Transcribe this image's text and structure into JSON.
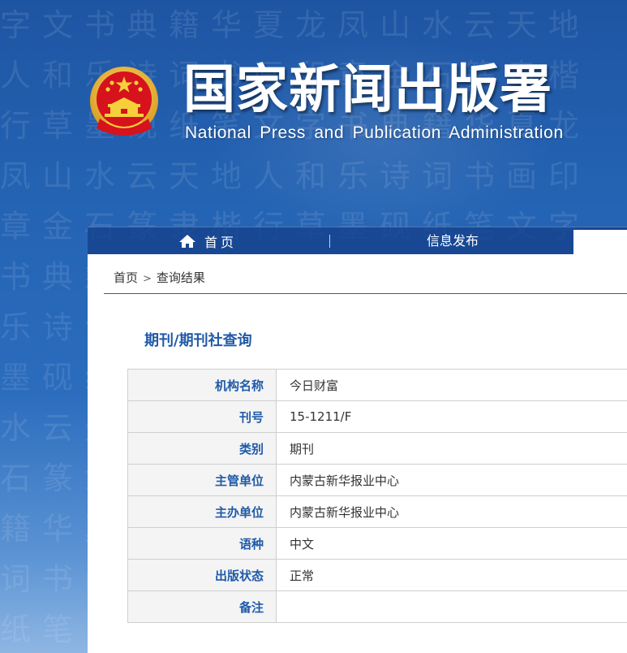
{
  "header": {
    "title": "国家新闻出版署",
    "subtitle": "National  Press and Publication Administration",
    "emblem_icon": "national-emblem-icon"
  },
  "nav": {
    "home_label": "首页",
    "info_label": "信息发布",
    "home_icon": "home-icon"
  },
  "breadcrumb": {
    "home": "首页",
    "separator": ">",
    "current": "查询结果"
  },
  "section": {
    "title": "期刊/期刊社查询"
  },
  "table": {
    "rows": [
      {
        "label": "机构名称",
        "value": "今日财富"
      },
      {
        "label": "刊号",
        "value": "15-1211/F"
      },
      {
        "label": "类别",
        "value": "期刊"
      },
      {
        "label": "主管单位",
        "value": "内蒙古新华报业中心"
      },
      {
        "label": "主办单位",
        "value": "内蒙古新华报业中心"
      },
      {
        "label": "语种",
        "value": "中文"
      },
      {
        "label": "出版状态",
        "value": "正常"
      },
      {
        "label": "备注",
        "value": ""
      }
    ]
  },
  "colors": {
    "brand_blue": "#1f5aa8",
    "nav_bg": "#16428c",
    "label_bg": "#f4f4f4",
    "emblem_red": "#d6121d",
    "emblem_gold": "#f3c23a"
  }
}
